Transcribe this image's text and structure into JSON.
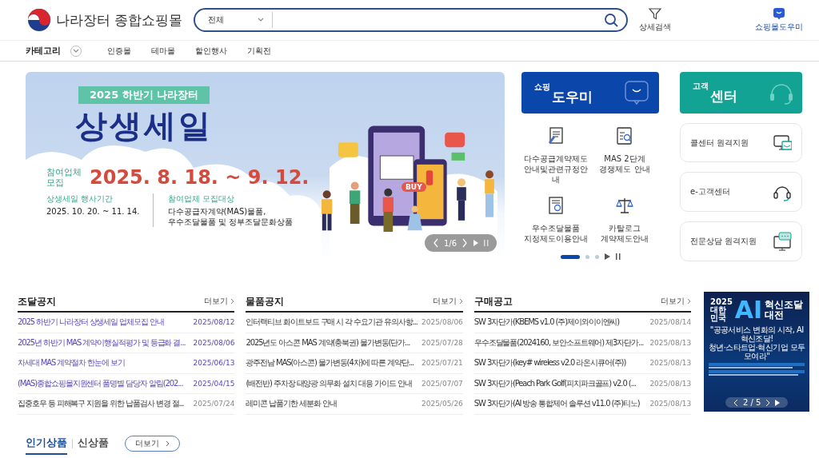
{
  "header": {
    "logo_text": "나라장터 종합쇼핑몰",
    "search": {
      "category": "전체"
    },
    "detail_search": "상세검색",
    "helper_link": "쇼핑몰도우미"
  },
  "nav": {
    "category_label": "카테고리",
    "items": [
      "인증몰",
      "테마몰",
      "할인행사",
      "기획전"
    ]
  },
  "hero_banner": {
    "badge": "2025 하반기 나라장터",
    "title": "상생세일",
    "recruit_label": "참여업체\n모집",
    "recruit_period": "2025. 8. 18. ~ 9. 12.",
    "event_label": "상생세일 행사기간",
    "event_period": "2025. 10. 20. ~ 11. 14.",
    "target_label": "참여업체 모집대상",
    "target_text": "다수공급자계약(MAS)물품,\n우수조달물품 및 정부조달문화상품",
    "button_text": "BUY",
    "pager": "1/6"
  },
  "shopping_helper": {
    "small_title": "쇼핑",
    "title": "도우미",
    "items": [
      {
        "kind": "document",
        "label": "다수공급계약제도\n안내및관련규정안내"
      },
      {
        "kind": "search-doc",
        "label": "MAS 2단계\n경쟁제도 안내"
      },
      {
        "kind": "certificate",
        "label": "우수조달물품\n지정제도이용안내"
      },
      {
        "kind": "scale",
        "label": "카탈로그\n계약제도안내"
      }
    ],
    "slides": [
      {
        "selected": true
      },
      {
        "selected": false
      },
      {
        "selected": false
      }
    ]
  },
  "customer_center": {
    "small_title": "고객",
    "title": "센터",
    "items": [
      {
        "kind": "remote",
        "label": "콜센터 원격지원"
      },
      {
        "kind": "headset",
        "label": "e-고객센터"
      },
      {
        "kind": "monitor-chat",
        "label": "전문상담 원격지원"
      }
    ]
  },
  "boards": [
    {
      "title": "조달공지",
      "more": "더보기",
      "rows": [
        {
          "title": "2025 하반기 나라장터 상생세일 업체모집 안내",
          "date": "2025/08/12",
          "highlighted": true
        },
        {
          "title": "2025년 하반기 MAS 계약이행실적평가 및 등급화 결...",
          "date": "2025/08/06",
          "highlighted": true
        },
        {
          "title": "차세대 MAS 계약절차 한눈에 보기",
          "date": "2025/06/13",
          "highlighted": true
        },
        {
          "title": "(MAS)종합쇼핑몰지원센터 품명별 담당자 알림(202...",
          "date": "2025/04/15",
          "highlighted": true
        },
        {
          "title": "집중호우 등 피해복구 지원을 위한 납품검사 변경 절...",
          "date": "2025/07/24",
          "highlighted": false
        }
      ]
    },
    {
      "title": "물품공지",
      "more": "더보기",
      "rows": [
        {
          "title": "인터랙티브 화이트보드 구매 시 각 수요기관 유의사항...",
          "date": "2025/08/06",
          "highlighted": false
        },
        {
          "title": "2025년도 아스콘 MAS 계약(충북권) 물가변동(단가...",
          "date": "2025/07/28",
          "highlighted": false
        },
        {
          "title": "광주전남 MAS(아스콘) 물가변동(4차)에 따른 계약단...",
          "date": "2025/07/21",
          "highlighted": false
        },
        {
          "title": "(배전반) 주차장 태양광 의무화 설치 대응 가이드 안내",
          "date": "2025/07/07",
          "highlighted": false
        },
        {
          "title": "레미콘 납품기한 세분화 안내",
          "date": "2025/05/26",
          "highlighted": false
        }
      ]
    },
    {
      "title": "구매공고",
      "more": "더보기",
      "rows": [
        {
          "title": "SW 3자단가(KBEMS v1.0 (주)제이와이이엔씨)",
          "date": "2025/08/14",
          "highlighted": false
        },
        {
          "title": "우수조달물품(2024160, 보안소프트웨어) 제3자단가...",
          "date": "2025/08/13",
          "highlighted": false
        },
        {
          "title": "SW 3자단가(key# wireless v2.0 라온시큐어(주))",
          "date": "2025/08/13",
          "highlighted": false
        },
        {
          "title": "SW 3자단가(Peach Park Golf(피치파크골프) v2.0 (...",
          "date": "2025/08/13",
          "highlighted": false
        },
        {
          "title": "SW 3자단가(AI 방송 통합제어 솔루션 v11.0 (주)티노)",
          "date": "2025/08/13",
          "highlighted": false
        }
      ]
    }
  ],
  "side_banner": {
    "year": "2025",
    "country": "대한\n민국",
    "ai": "AI",
    "title": "혁신조달\n대전",
    "quote": "\"공공서비스 변화의 시작, AI 혁신조달!\n청년·스타트업·혁신기업 모두 모여라\"",
    "pager": "2 / 5"
  },
  "product_tabs": {
    "tabs": [
      {
        "label": "인기상품",
        "selected": true
      },
      {
        "label": "신상품",
        "selected": false
      }
    ],
    "more": "더보기"
  }
}
